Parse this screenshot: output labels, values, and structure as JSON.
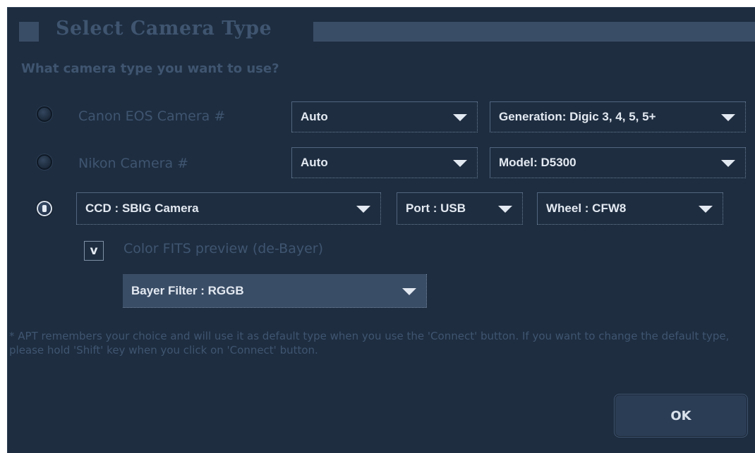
{
  "dialog": {
    "title": "Select Camera Type",
    "question": "What camera type you want to use?"
  },
  "options": {
    "canon": {
      "label": "Canon EOS Camera #",
      "selected": false,
      "camera_dropdown": "Auto",
      "generation_dropdown": "Generation: Digic 3, 4, 5, 5+"
    },
    "nikon": {
      "label": "Nikon Camera #",
      "selected": false,
      "camera_dropdown": "Auto",
      "model_dropdown": "Model: D5300"
    },
    "ccd": {
      "selected": true,
      "type_dropdown": "CCD : SBIG Camera",
      "port_dropdown": "Port : USB",
      "wheel_dropdown": "Wheel : CFW8",
      "color_preview": {
        "checked": true,
        "check_mark": "v",
        "label": "Color FITS preview (de-Bayer)"
      },
      "bayer_dropdown": "Bayer Filter : RGGB"
    }
  },
  "note": "* APT remembers your choice and will use it as default type when you use the 'Connect' button. If you want to change the default type, please hold 'Shift' key when you click on 'Connect' button.",
  "ok_button": "OK",
  "colors": {
    "background": "#1e2d40",
    "panel": "#3a4d66",
    "muted_text": "#3f5570",
    "bright_text": "#e3e9f1"
  }
}
